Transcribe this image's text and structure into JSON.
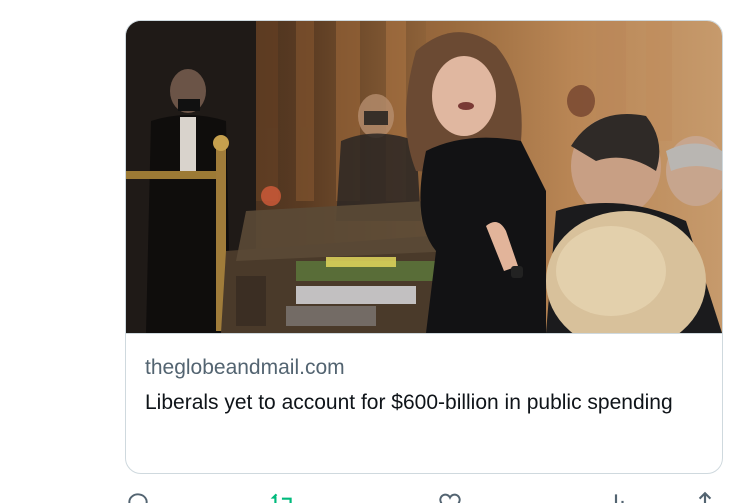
{
  "card": {
    "domain": "theglobeandmail.com",
    "headline": "Liberals yet to account for $600-billion in public spending",
    "image_icon": "news-photo"
  },
  "actions": {
    "reply_icon": "reply-icon",
    "retweet_icon": "retweet-icon",
    "like_icon": "heart-icon",
    "views_icon": "views-icon",
    "share_icon": "share-icon",
    "retweet_color": "#00ba7c",
    "muted_color": "#536471"
  }
}
